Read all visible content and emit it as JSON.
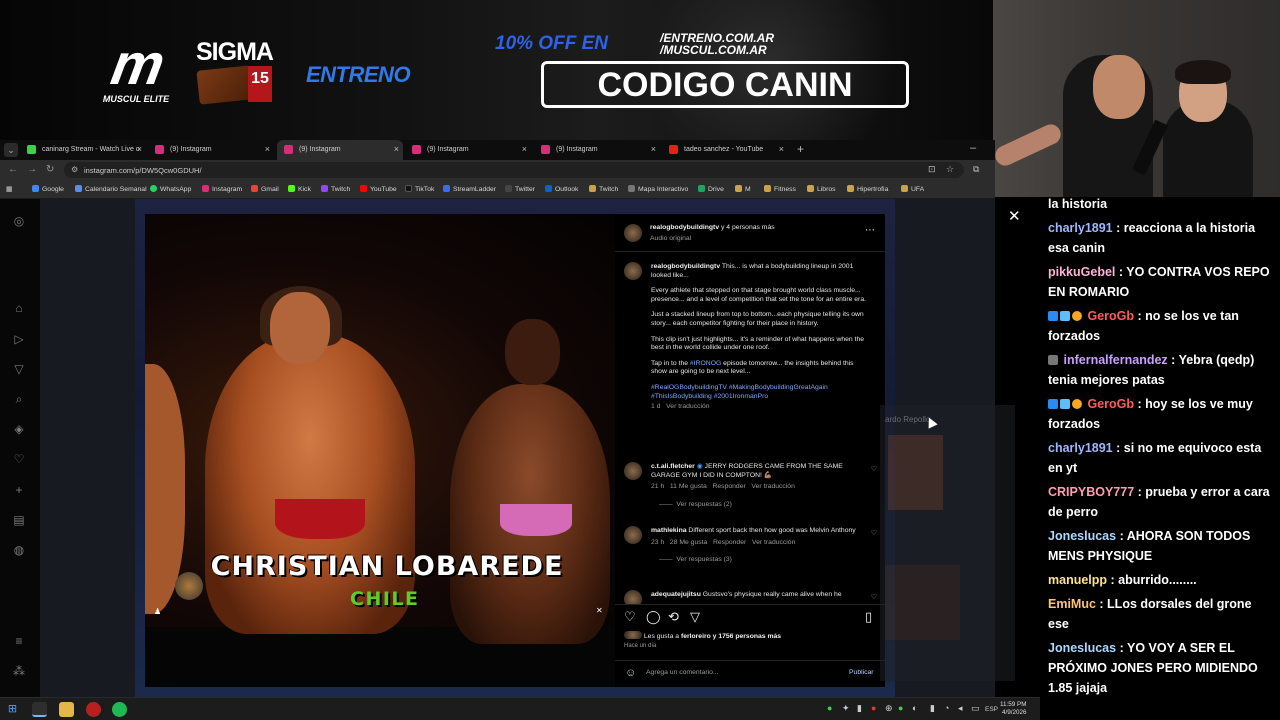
{
  "banner": {
    "brand": "MUSCUL ELITE",
    "sigma_title": "SIGMA",
    "sigma_badge": "15",
    "entreno": "ENTRENO",
    "promo_line": "10% OFF EN",
    "promo_url_1": "/ENTRENO.COM.AR",
    "promo_url_2": "/MUSCUL.COM.AR",
    "promo_code": "CODIGO CANIN"
  },
  "browser": {
    "tabs": [
      {
        "title": "caninarg Stream - Watch Live o",
        "color": "#3ad24c"
      },
      {
        "title": "(9) Instagram",
        "color": "#d62e79"
      },
      {
        "title": "(9) Instagram",
        "color": "#d62e79",
        "active": true
      },
      {
        "title": "(9) Instagram",
        "color": "#d62e79"
      },
      {
        "title": "(9) Instagram",
        "color": "#d62e79"
      },
      {
        "title": "tadeo sanchez - YouTube",
        "color": "#e62117"
      }
    ],
    "url": "instagram.com/p/DW5Qcw0GDUH/",
    "bookmarks": [
      "Google",
      "Calendario Semanal",
      "WhatsApp",
      "Instagram",
      "Gmail",
      "Kick",
      "Twitch",
      "YouTube",
      "TikTok",
      "StreamLadder",
      "Twitter",
      "Outlook",
      "Twitch",
      "Mapa Interactivo",
      "Drive",
      "M",
      "Fitness",
      "Libros",
      "Hipertrofia",
      "UFA"
    ]
  },
  "video": {
    "name": "CHRISTIAN LOBAREDE",
    "country": "CHILE"
  },
  "post": {
    "author": "realogbodybuildingtv",
    "author_suffix": "y 4 personas más",
    "audio": "Audio original",
    "caption_user": "realogbodybuildingtv",
    "caption_first": "This... is what a bodybuilding lineup in 2001 looked like...",
    "caption_p2": "Every athlete that stepped on that stage brought world class muscle... presence... and a level of competition that set the tone for an entire era.",
    "caption_p3": "Just a stacked lineup from top to bottom...each physique telling its own story... each competitor fighting for their place in history.",
    "caption_p4": "This clip isn't just highlights... it's a reminder of what happens when the best in the world collide under one roof.",
    "caption_p5a": "Tap in to the",
    "caption_p5_tag": "#IRONOG",
    "caption_p5b": "episode tomorrow... the insights behind this show are going to be next level...",
    "hashtags": "#RealOGBodybuildingTV #MakingBodybuildingGreatAgain #ThisIsBodybuilding #2001IronmanPro",
    "caption_time": "1 d",
    "see_translation": "Ver traducción",
    "comments": [
      {
        "user": "c.t.ali.fletcher",
        "text": "JERRY RODGERS CAME FROM THE SAME GARAGE GYM I DID IN COMPTON! 💪🏽",
        "time": "21 h",
        "likes": "11 Me gusta",
        "reply": "Responder",
        "translate": "Ver traducción",
        "replies": "Ver respuestas (2)"
      },
      {
        "user": "mathlekina",
        "text": "Different sport back then how good was Melvin Anthony",
        "time": "23 h",
        "likes": "28 Me gusta",
        "reply": "Responder",
        "translate": "Ver traducción",
        "replies": "Ver respuestas (3)"
      },
      {
        "user": "adequatejujitsu",
        "text": "Gustsvo's physique really came alive when he"
      }
    ],
    "likes_text_pre": "Les gusta a",
    "likes_user": "ferloreiro",
    "likes_text_post": "y 1756 personas más",
    "posted": "Hace un día",
    "comment_placeholder": "Agrega un comentario...",
    "publish": "Publicar"
  },
  "miniplayer": {
    "title": "ardo Repollo"
  },
  "chat": {
    "messages": [
      {
        "user": "",
        "color": "#ffffff",
        "text": "la historia"
      },
      {
        "user": "charly1891",
        "color": "#9fb7ff",
        "text": "reacciona a la historia esa canin"
      },
      {
        "user": "pikkuGebel",
        "color": "#ffb0d8",
        "text": "YO CONTRA VOS REPO EN ROMARIO"
      },
      {
        "user": "GeroGb",
        "color": "#ff5c5c",
        "text": "no se los ve tan forzados",
        "badges": true
      },
      {
        "user": "infernalfernandez",
        "color": "#c9a0ff",
        "text": "Yebra (qedp) tenia mejores patas",
        "badges_one": true
      },
      {
        "user": "GeroGb",
        "color": "#ff5c5c",
        "text": "hoy se los ve muy forzados",
        "badges": true
      },
      {
        "user": "charly1891",
        "color": "#9fb7ff",
        "text": "si no me equivoco esta en yt"
      },
      {
        "user": "CRIPYBOY777",
        "color": "#ff9db0",
        "text": "prueba y error a cara de perro"
      },
      {
        "user": "Joneslucas",
        "color": "#a8d8ff",
        "text": "AHORA SON TODOS MENS PHYSIQUE"
      },
      {
        "user": "manuelpp",
        "color": "#ffe08a",
        "text": "aburrido........"
      },
      {
        "user": "EmiMuc",
        "color": "#ffc27a",
        "text": "LLos dorsales del grone ese"
      },
      {
        "user": "Joneslucas",
        "color": "#a8d8ff",
        "text": "YO VOY A SER EL PRÓXIMO JONES PERO MIDIENDO 1.85 jajaja"
      }
    ]
  },
  "taskbar": {
    "lang": "ESP",
    "time": "11:59 PM",
    "date": "4/9/2026"
  }
}
